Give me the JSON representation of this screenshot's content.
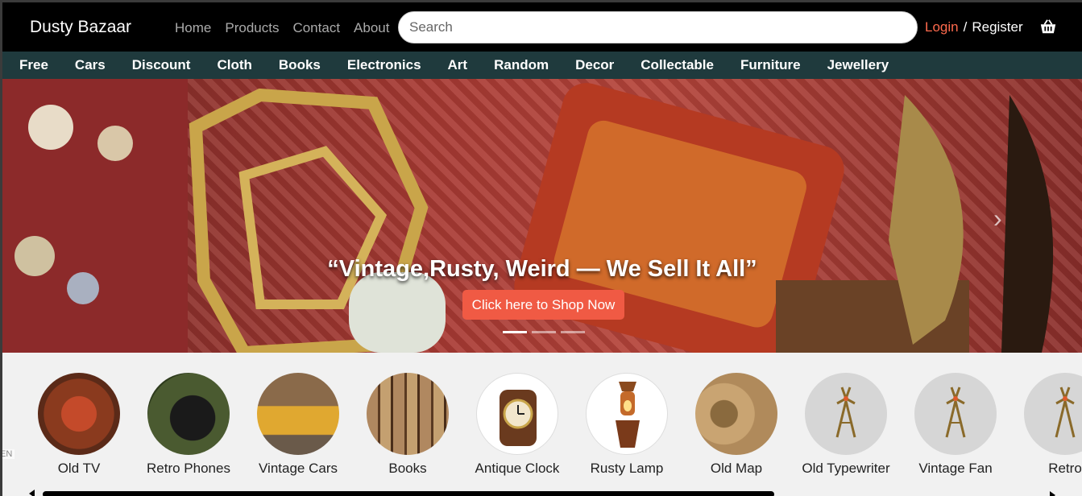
{
  "header": {
    "brand": "Dusty Bazaar",
    "nav": [
      "Home",
      "Products",
      "Contact",
      "About"
    ],
    "search_placeholder": "Search",
    "login": "Login",
    "slash": "/",
    "register": "Register"
  },
  "categories": [
    "Free",
    "Cars",
    "Discount",
    "Cloth",
    "Books",
    "Electronics",
    "Art",
    "Random",
    "Decor",
    "Collectable",
    "Furniture",
    "Jewellery"
  ],
  "hero": {
    "headline": "“Vintage,Rusty, Weird — We Sell It All”",
    "cta": "Click here to Shop Now",
    "next": "›"
  },
  "products": [
    {
      "label": "Old TV",
      "color": "#a9492f"
    },
    {
      "label": "Retro Phones",
      "color": "#3d4a2b"
    },
    {
      "label": "Vintage Cars",
      "color": "#d9a43a"
    },
    {
      "label": "Books",
      "color": "#9b7a55"
    },
    {
      "label": "Antique Clock",
      "color": "#ffffff"
    },
    {
      "label": "Rusty Lamp",
      "color": "#ffffff"
    },
    {
      "label": "Old Map",
      "color": "#b08a5b"
    },
    {
      "label": "Old Typewriter",
      "color": "#d6d6d6"
    },
    {
      "label": "Vintage Fan",
      "color": "#d6d6d6"
    },
    {
      "label": "Retro",
      "color": "#d6d6d6"
    }
  ],
  "lang": "EN",
  "colors": {
    "accent": "#f05a44",
    "catbar": "#1f3a3d",
    "login": "#ff6a4d"
  }
}
